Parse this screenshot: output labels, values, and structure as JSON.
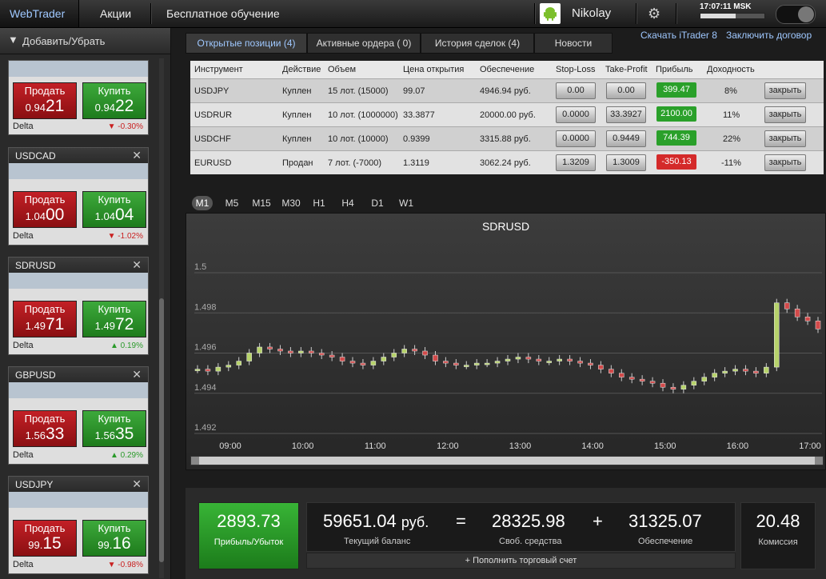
{
  "nav": {
    "brand": "WebTrader",
    "items": [
      "Акции",
      "Бесплатное обучение"
    ],
    "user": "Nikolay",
    "clock": "17:07:11 MSK"
  },
  "left": {
    "add_remove": "Добавить/Убрать",
    "sell_label": "Продать",
    "buy_label": "Купить",
    "delta_label": "Delta",
    "cards": [
      {
        "symbol": "",
        "sell_prefix": "0.94",
        "sell_big": "21",
        "buy_prefix": "0.94",
        "buy_big": "22",
        "delta": "▼ -0.30%",
        "dir": "dn"
      },
      {
        "symbol": "USDCAD",
        "sell_prefix": "1.04",
        "sell_big": "00",
        "buy_prefix": "1.04",
        "buy_big": "04",
        "delta": "▼ -1.02%",
        "dir": "dn"
      },
      {
        "symbol": "SDRUSD",
        "sell_prefix": "1.49",
        "sell_big": "71",
        "buy_prefix": "1.49",
        "buy_big": "72",
        "delta": "▲ 0.19%",
        "dir": "up"
      },
      {
        "symbol": "GBPUSD",
        "sell_prefix": "1.56",
        "sell_big": "33",
        "buy_prefix": "1.56",
        "buy_big": "35",
        "delta": "▲ 0.29%",
        "dir": "up"
      },
      {
        "symbol": "USDJPY",
        "sell_prefix": "99.",
        "sell_big": "15",
        "buy_prefix": "99.",
        "buy_big": "16",
        "delta": "▼ -0.98%",
        "dir": "dn"
      }
    ]
  },
  "tabs": [
    "Открытые позиции (4)",
    "Активные ордера ( 0)",
    "История сделок (4)",
    "Новости"
  ],
  "links": {
    "download": "Скачать iTrader 8",
    "contract": "Заключить договор"
  },
  "positions": {
    "headers": [
      "Инструмент",
      "Действие",
      "Объем",
      "Цена открытия",
      "Обеспечение",
      "Stop-Loss",
      "Take-Profit",
      "Прибыль",
      "Доходность"
    ],
    "close_label": "закрыть",
    "rows": [
      {
        "instr": "USDJPY",
        "action": "Куплен",
        "volume": "15 лот. (15000)",
        "open": "99.07",
        "margin": "4946.94 руб.",
        "sl": "0.00",
        "tp": "0.00",
        "profit": "399.47",
        "yield": "8%",
        "pos": true
      },
      {
        "instr": "USDRUR",
        "action": "Куплен",
        "volume": "10 лот. (1000000)",
        "open": "33.3877",
        "margin": "20000.00 руб.",
        "sl": "0.0000",
        "tp": "33.3927",
        "profit": "2100.00",
        "yield": "11%",
        "pos": true
      },
      {
        "instr": "USDCHF",
        "action": "Куплен",
        "volume": "10 лот. (10000)",
        "open": "0.9399",
        "margin": "3315.88 руб.",
        "sl": "0.0000",
        "tp": "0.9449",
        "profit": "744.39",
        "yield": "22%",
        "pos": true
      },
      {
        "instr": "EURUSD",
        "action": "Продан",
        "volume": "7 лот. (-7000)",
        "open": "1.3119",
        "margin": "3062.24 руб.",
        "sl": "1.3209",
        "tp": "1.3009",
        "profit": "-350.13",
        "yield": "-11%",
        "pos": false
      }
    ]
  },
  "timeframes": [
    "M1",
    "M5",
    "M15",
    "M30",
    "H1",
    "H4",
    "D1",
    "W1"
  ],
  "chart_data": {
    "type": "candlestick",
    "title": "SDRUSD",
    "xlabels": [
      "09:00",
      "10:00",
      "11:00",
      "12:00",
      "13:00",
      "14:00",
      "15:00",
      "16:00",
      "17:00"
    ],
    "ylabels": [
      "1.5",
      "1.498",
      "1.496",
      "1.494",
      "1.492"
    ],
    "ylim": [
      1.492,
      1.5
    ],
    "series": [
      {
        "values": [
          1.4952,
          1.4951,
          1.4953,
          1.4954,
          1.4956,
          1.496,
          1.4963,
          1.4962,
          1.4961,
          1.496,
          1.4961,
          1.496,
          1.4959,
          1.4958,
          1.4956,
          1.4955,
          1.4954,
          1.4956,
          1.4958,
          1.496,
          1.4962,
          1.4961,
          1.4959,
          1.4956,
          1.4955,
          1.4954,
          1.4954,
          1.4955,
          1.4955,
          1.4956,
          1.4957,
          1.4958,
          1.4957,
          1.4956,
          1.4956,
          1.4957,
          1.4956,
          1.4955,
          1.4954,
          1.4952,
          1.495,
          1.4948,
          1.4947,
          1.4946,
          1.4945,
          1.4943,
          1.4942,
          1.4944,
          1.4946,
          1.4948,
          1.495,
          1.4951,
          1.4952,
          1.4951,
          1.495,
          1.4953,
          1.4985,
          1.4982,
          1.4978,
          1.4976,
          1.4972
        ]
      }
    ]
  },
  "summary": {
    "pnl_value": "2893.73",
    "pnl_label": "Прибыль/Убыток",
    "balance_value": "59651.04",
    "balance_unit": "руб.",
    "balance_label": "Текущий баланс",
    "eq": "=",
    "free_value": "28325.98",
    "free_label": "Своб. средства",
    "plus": "+",
    "margin_value": "31325.07",
    "margin_label": "Обеспечение",
    "add_account": "+ Пополнить торговый счет",
    "commission_value": "20.48",
    "commission_label": "Комиссия"
  }
}
